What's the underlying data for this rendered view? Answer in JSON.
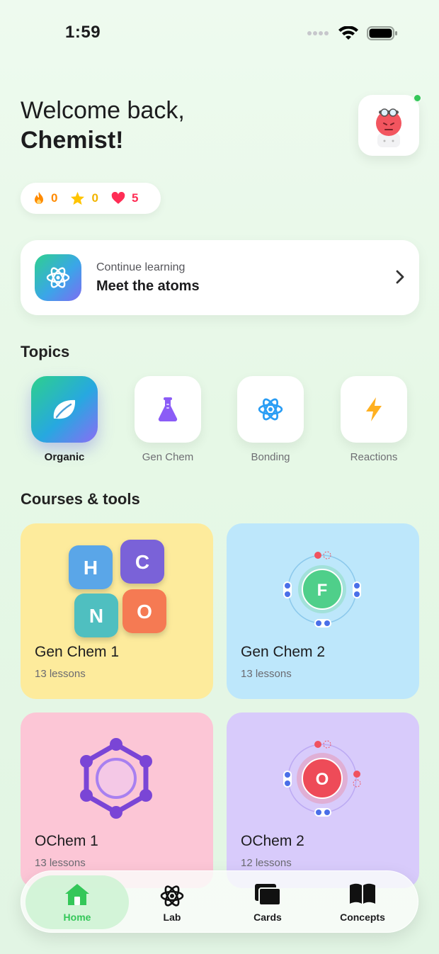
{
  "status": {
    "time": "1:59"
  },
  "header": {
    "greeting": "Welcome back,",
    "name": "Chemist!"
  },
  "stats": [
    {
      "icon": "flame-icon",
      "value": "0",
      "color": "#ff8a00"
    },
    {
      "icon": "star-icon",
      "value": "0",
      "color": "#ffc400"
    },
    {
      "icon": "heart-icon",
      "value": "5",
      "color": "#ff2d55"
    }
  ],
  "continue": {
    "subtitle": "Continue learning",
    "title": "Meet the atoms"
  },
  "topics_section": {
    "title": "Topics"
  },
  "topics": [
    {
      "label": "Organic",
      "icon": "leaf-icon",
      "active": true
    },
    {
      "label": "Gen Chem",
      "icon": "flask-icon",
      "active": false
    },
    {
      "label": "Bonding",
      "icon": "atom-icon",
      "active": false
    },
    {
      "label": "Reactions",
      "icon": "bolt-icon",
      "active": false
    }
  ],
  "courses_section": {
    "title": "Courses & tools"
  },
  "courses": [
    {
      "name": "Gen Chem 1",
      "count": "13 lessons",
      "color": "#fdeb9c",
      "tiles": [
        "H",
        "C",
        "N",
        "O"
      ]
    },
    {
      "name": "Gen Chem 2",
      "count": "13 lessons",
      "color": "#bde7fb",
      "atom": "F"
    },
    {
      "name": "OChem 1",
      "count": "13 lessons",
      "color": "#fcc6d6"
    },
    {
      "name": "OChem 2",
      "count": "12 lessons",
      "color": "#d8cbfb",
      "atom": "O"
    }
  ],
  "tabbar": [
    {
      "label": "Home",
      "icon": "home-icon",
      "active": true
    },
    {
      "label": "Lab",
      "icon": "atom-icon",
      "active": false
    },
    {
      "label": "Cards",
      "icon": "cards-icon",
      "active": false
    },
    {
      "label": "Concepts",
      "icon": "book-icon",
      "active": false
    }
  ]
}
